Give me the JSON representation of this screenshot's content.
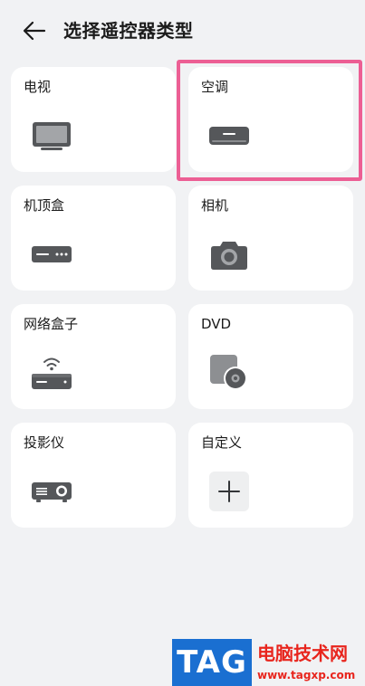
{
  "header": {
    "back_icon": "arrow-left-icon",
    "title": "选择遥控器类型"
  },
  "devices": [
    {
      "label": "电视",
      "icon": "tv-icon"
    },
    {
      "label": "空调",
      "icon": "air-conditioner-icon",
      "highlighted": true
    },
    {
      "label": "机顶盒",
      "icon": "set-top-box-icon"
    },
    {
      "label": "相机",
      "icon": "camera-icon"
    },
    {
      "label": "网络盒子",
      "icon": "network-box-icon"
    },
    {
      "label": "DVD",
      "icon": "dvd-icon"
    },
    {
      "label": "投影仪",
      "icon": "projector-icon"
    },
    {
      "label": "自定义",
      "icon": "plus-icon"
    }
  ],
  "colors": {
    "background": "#f1f2f4",
    "card": "#ffffff",
    "icon": "#55575a",
    "highlight": "#ec5f94",
    "watermark_blue": "#1a6fd1",
    "watermark_red": "#e8251d"
  },
  "watermark": {
    "tag": "TAG",
    "name": "电脑技术网",
    "url": "www.tagxp.com"
  }
}
